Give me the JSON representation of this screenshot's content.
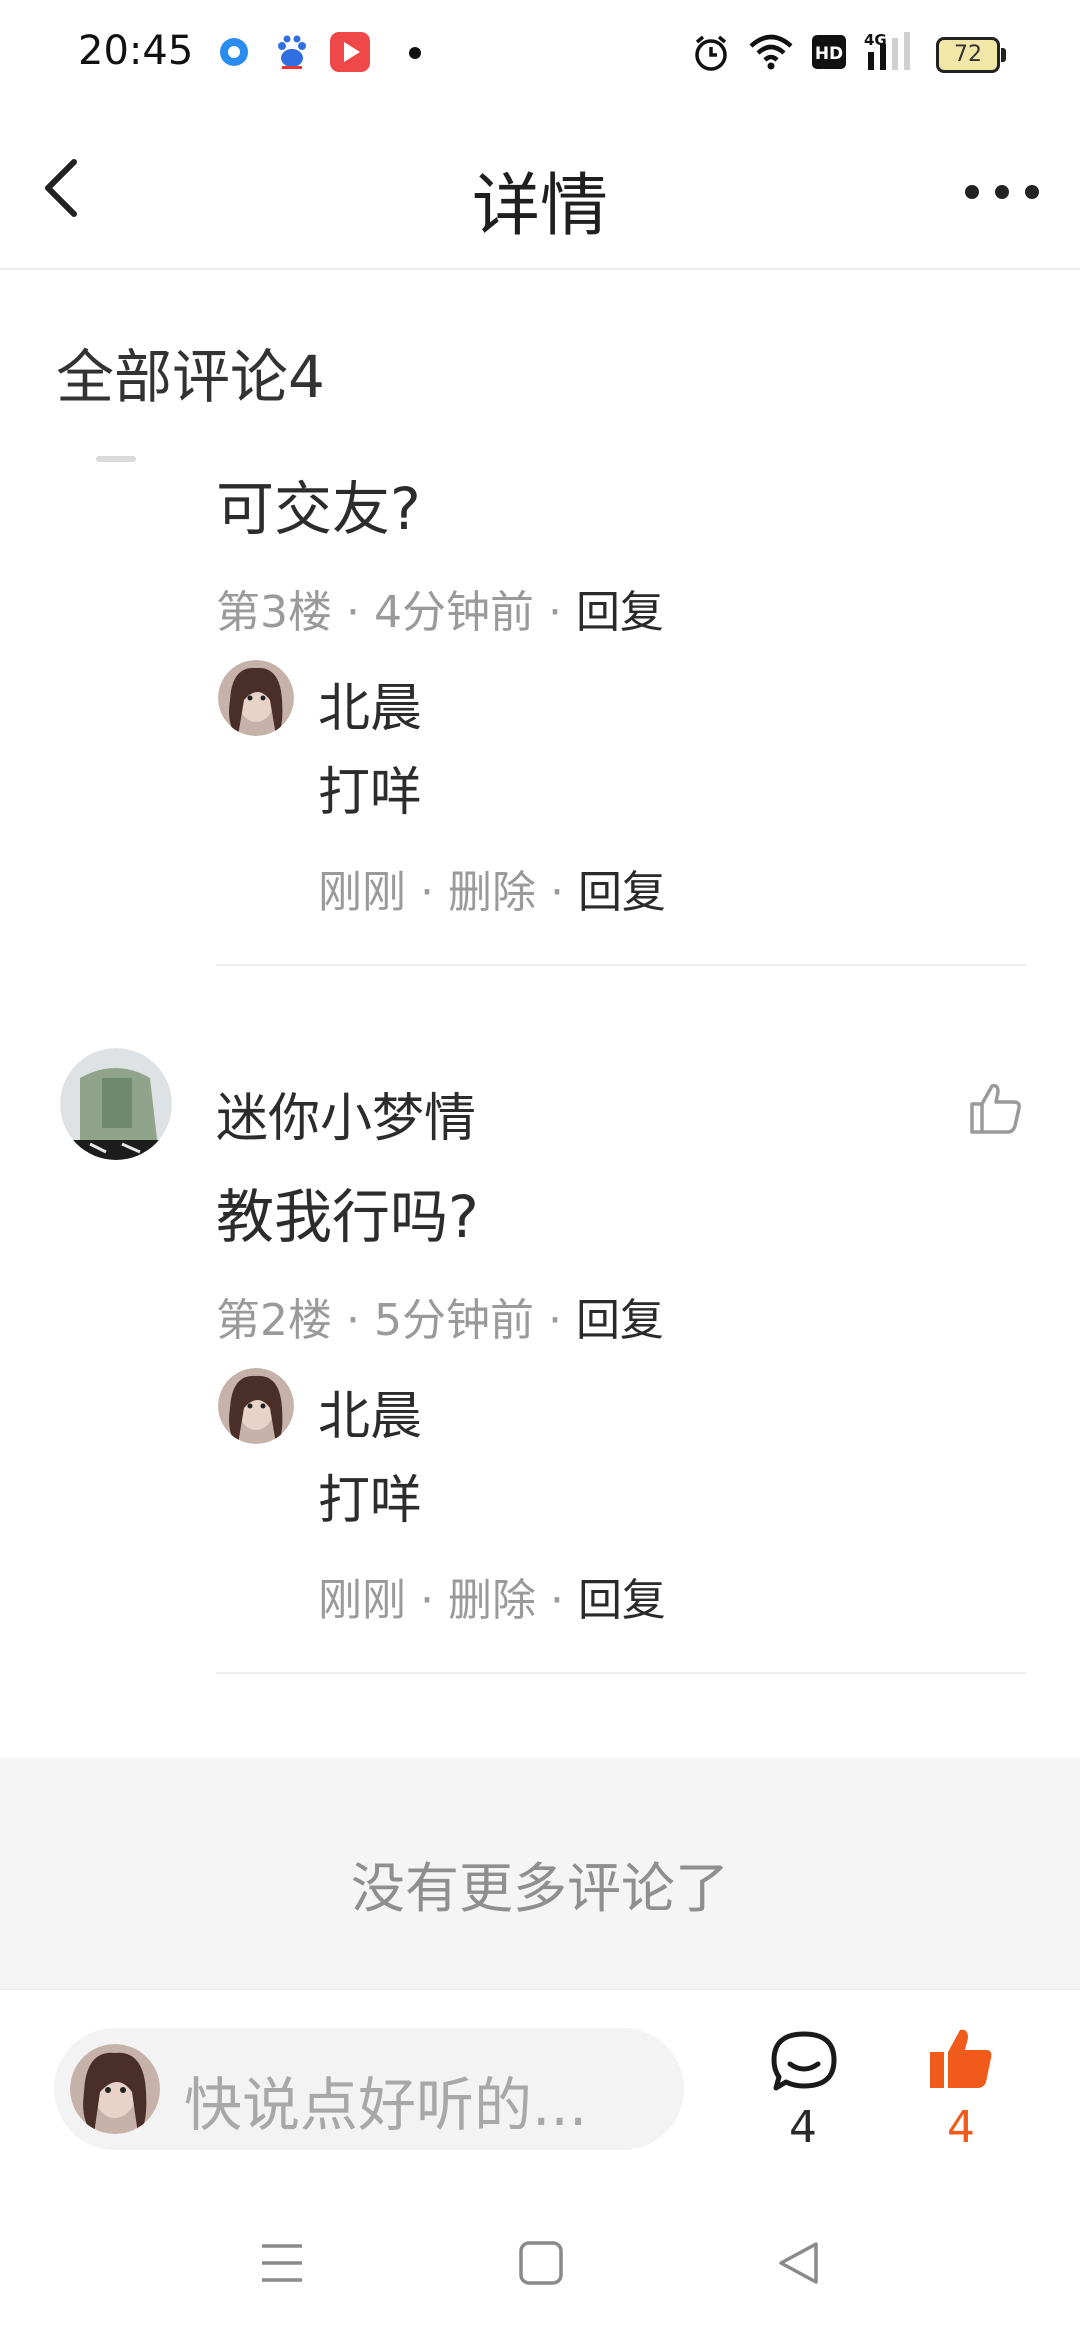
{
  "status_bar": {
    "time": "20:45",
    "battery": "72"
  },
  "header": {
    "title": "详情"
  },
  "comments_section": {
    "title": "全部评论4"
  },
  "comments": [
    {
      "text": "可交友?",
      "floor": "第3楼",
      "time": "4分钟前",
      "reply_label": "回复",
      "reply": {
        "author": "北晨",
        "text": "打咩",
        "time": "刚刚",
        "delete_label": "删除",
        "reply_label": "回复"
      }
    },
    {
      "author": "迷你小梦情",
      "text": "教我行吗?",
      "floor": "第2楼",
      "time": "5分钟前",
      "reply_label": "回复",
      "reply": {
        "author": "北晨",
        "text": "打咩",
        "time": "刚刚",
        "delete_label": "删除",
        "reply_label": "回复"
      }
    }
  ],
  "no_more": "没有更多评论了",
  "bottom_bar": {
    "input_placeholder": "快说点好听的...",
    "comment_count": "4",
    "like_count": "4",
    "like_color": "#f05a1a"
  },
  "icons": [
    "back-icon",
    "more-icon",
    "thumbs-up-outline-icon",
    "comment-bubble-icon",
    "thumbs-up-filled-icon",
    "menu-icon",
    "home-square-icon",
    "back-triangle-icon"
  ]
}
